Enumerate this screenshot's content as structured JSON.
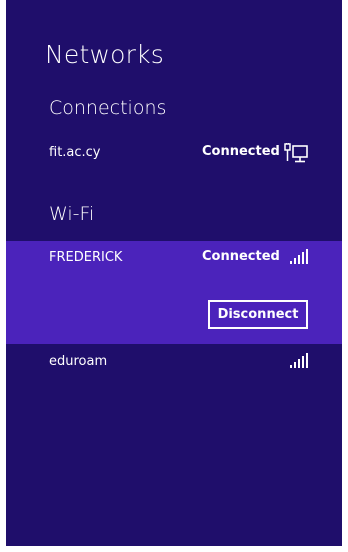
{
  "panel": {
    "title": "Networks"
  },
  "connections": {
    "heading": "Connections",
    "items": [
      {
        "name": "fit.ac.cy",
        "status": "Connected",
        "icon": "wired-network-icon"
      }
    ]
  },
  "wifi": {
    "heading": "Wi-Fi",
    "items": [
      {
        "name": "FREDERICK",
        "status": "Connected",
        "icon": "wifi-signal-icon",
        "disconnect_label": "Disconnect"
      },
      {
        "name": "eduroam",
        "status": "",
        "icon": "wifi-signal-icon"
      }
    ]
  },
  "colors": {
    "panel_bg": "#1f0e6b",
    "selected_bg": "#4b23bb",
    "text": "#ffffff"
  }
}
